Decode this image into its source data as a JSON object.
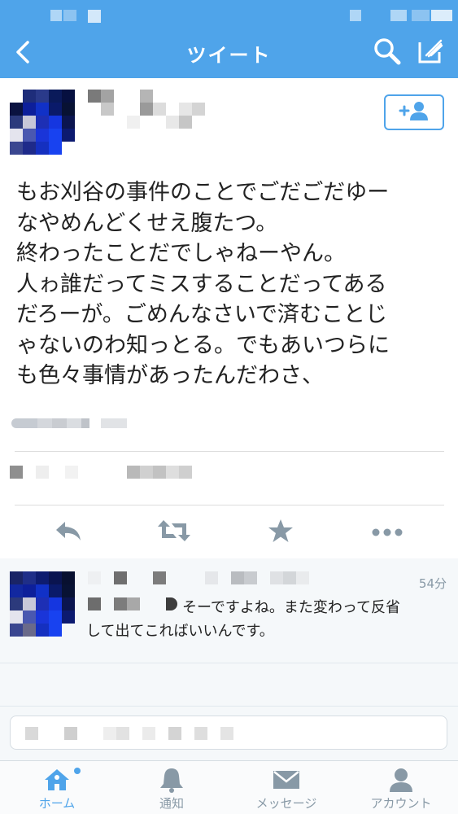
{
  "header": {
    "title": "ツイート",
    "background": "#4fa4ea",
    "icons": [
      "back-chevron-icon",
      "search-icon",
      "compose-icon"
    ]
  },
  "tweet": {
    "text_lines": [
      "もお刈谷の事件のことでごだごだゆー",
      "なやめんどくせえ腹たつ。",
      "終わったことだでしゃねーやん。",
      "人ゎ誰だってミスすることだってある",
      "だろーが。ごめんなさいで済むことじ",
      "ゃないのわ知っとる。でもあいつらに",
      "も色々事情があったんだわさ、"
    ],
    "follow_icon": "add-user-icon"
  },
  "actions": {
    "reply_icon": "reply-icon",
    "retweet_icon": "retweet-icon",
    "favorite_icon": "star-icon",
    "more_icon": "more-icon"
  },
  "reply": {
    "time": "54分",
    "line1": "そーですよね。また変わって反省",
    "line2": "して出てこればいいんです。"
  },
  "tabbar": {
    "items": [
      {
        "label": "ホーム",
        "icon": "home-icon",
        "active": true
      },
      {
        "label": "通知",
        "icon": "bell-icon",
        "active": false
      },
      {
        "label": "メッセージ",
        "icon": "envelope-icon",
        "active": false
      },
      {
        "label": "アカウント",
        "icon": "person-icon",
        "active": false
      }
    ]
  },
  "colors": {
    "accent": "#4fa4ea",
    "text": "#222222",
    "muted": "#8899a6"
  }
}
